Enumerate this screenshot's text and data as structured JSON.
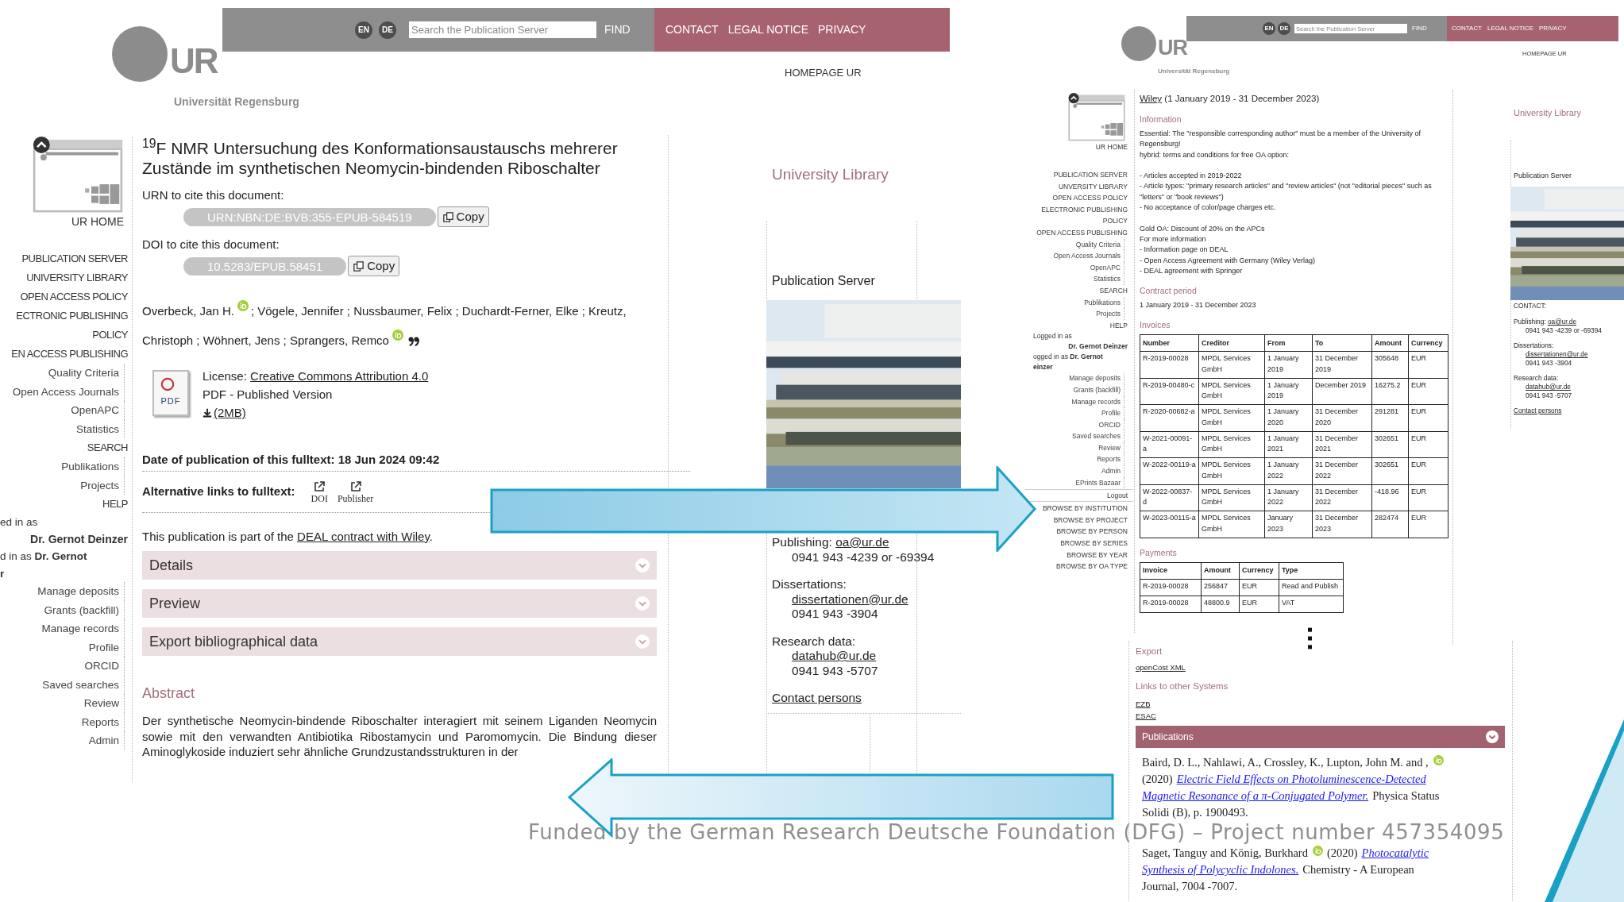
{
  "left_page": {
    "logo": {
      "mark": "UR",
      "name": "Universität Regensburg"
    },
    "languages": [
      {
        "label": "EN"
      },
      {
        "label": "DE"
      }
    ],
    "search": {
      "placeholder": "Search the Publication Server",
      "button": "FIND"
    },
    "top_links": [
      "CONTACT",
      "LEGAL NOTICE",
      "PRIVACY"
    ],
    "homepage_link": "HOMEPAGE UR",
    "home_label": "UR HOME",
    "sidebar": [
      {
        "kind": "main",
        "label": "PUBLICATION SERVER"
      },
      {
        "kind": "main",
        "label": "UNIVERSITY LIBRARY"
      },
      {
        "kind": "main",
        "label": "OPEN ACCESS POLICY"
      },
      {
        "kind": "main",
        "label": "ECTRONIC PUBLISHING"
      },
      {
        "kind": "main",
        "label": "POLICY"
      },
      {
        "kind": "main",
        "label": "EN ACCESS PUBLISHING"
      },
      {
        "kind": "sub",
        "label": "Quality Criteria"
      },
      {
        "kind": "sub",
        "label": "Open Access Journals"
      },
      {
        "kind": "sub",
        "label": "OpenAPC"
      },
      {
        "kind": "sub",
        "label": "Statistics"
      },
      {
        "kind": "main",
        "label": "SEARCH"
      },
      {
        "kind": "sub",
        "label": "Publikations"
      },
      {
        "kind": "sub",
        "label": "Projects"
      },
      {
        "kind": "main",
        "label": "HELP"
      },
      {
        "kind": "login",
        "label": "ed in as"
      },
      {
        "kind": "user",
        "label": "Dr. Gernot Deinzer"
      },
      {
        "kind": "login",
        "label": "d in as **Dr. Gernot**"
      },
      {
        "kind": "login",
        "label": "**r**"
      },
      {
        "kind": "sub",
        "label": "Manage deposits"
      },
      {
        "kind": "sub",
        "label": "Grants (backfill)"
      },
      {
        "kind": "sub",
        "label": "Manage records"
      },
      {
        "kind": "sub",
        "label": "Profile"
      },
      {
        "kind": "sub",
        "label": "ORCID"
      },
      {
        "kind": "sub",
        "label": "Saved searches"
      },
      {
        "kind": "sub",
        "label": "Review"
      },
      {
        "kind": "sub",
        "label": "Reports"
      },
      {
        "kind": "sub",
        "label": "Admin"
      }
    ],
    "record": {
      "title": "$^{19}$F NMR Untersuchung des Konformationsaustauschs mehrerer Zustände im synthetischen Neomycin-bindenden Riboschalter",
      "identifiers": [
        {
          "label": "URN to cite this document:",
          "value": "URN:NBN:DE:BVB:355-EPUB-584519",
          "button": "Copy"
        },
        {
          "label": "DOI to cite this document:",
          "value": "10.5283/EPUB.58451",
          "button": "Copy"
        }
      ],
      "author_lines": [
        [
          {
            "kind": "text",
            "text": "Overbeck, Jan H."
          },
          {
            "kind": "orcid"
          },
          {
            "kind": "text",
            "text": "; Vögele, Jennifer ; Nussbaumer, Felix ; Duchardt-Ferner, Elke ; Kreutz,"
          }
        ],
        [
          {
            "kind": "text",
            "text": "Christoph ; Wöhnert, Jens ; Sprangers, Remco"
          },
          {
            "kind": "orcid"
          },
          {
            "kind": "cite"
          }
        ]
      ],
      "file": {
        "icon_label": "PDF",
        "license_label": "License: ",
        "license_link": "Creative Commons Attribution 4.0",
        "version": "PDF - Published Version",
        "download": "(2MB)"
      },
      "date": "Date of publication of this fulltext: 18 Jun 2024 09:42",
      "alt_links": {
        "label": "Alternative links to fulltext:",
        "links": [
          "DOI",
          "Publisher"
        ]
      },
      "deal_notice": {
        "before": "This publication is part of the ",
        "link": "DEAL contract with Wiley",
        "after": "."
      },
      "accordions": [
        {
          "label": "Details",
          "expanded": false
        },
        {
          "label": "Preview",
          "expanded": false
        },
        {
          "label": "Export bibliographical data",
          "expanded": false
        }
      ],
      "abstract": {
        "heading": "Abstract",
        "text": "Der synthetische Neomycin-bindende Riboschalter interagiert mit seinem Liganden Neomycin sowie mit den verwandten Antibiotika Ribostamycin und Paromomycin. Die Bindung dieser Aminoglykoside induziert sehr ähnliche Grundzustandsstrukturen in der"
      }
    },
    "side": {
      "heading": "University Library",
      "server": "Publication Server",
      "contacts": [
        {
          "kind": "inline",
          "label": "Publishing:",
          "email": "oa@ur.de",
          "phone": "0941 943 -4239 or -69394"
        },
        {
          "kind": "stacked",
          "label": "Dissertations:",
          "email": "dissertationen@ur.de",
          "phone": "0941 943 -3904"
        },
        {
          "kind": "stacked",
          "label": "Research data:",
          "email": "datahub@ur.de",
          "phone": "0941 943 -5707"
        }
      ],
      "contact_persons": "Contact persons"
    }
  },
  "right_page": {
    "logo": {
      "mark": "UR",
      "name": "Universität Regensburg"
    },
    "languages": [
      {
        "label": "EN"
      },
      {
        "label": "DE"
      }
    ],
    "search": {
      "placeholder": "Search the Publication Server",
      "button": "FIND"
    },
    "top_links": [
      "CONTACT",
      "LEGAL NOTICE",
      "PRIVACY"
    ],
    "homepage_link": "HOMEPAGE UR",
    "home_label": "UR HOME",
    "sidebar": [
      {
        "kind": "main",
        "label": "PUBLICATION SERVER"
      },
      {
        "kind": "main",
        "label": "UNVERSITY LIBRARY"
      },
      {
        "kind": "main",
        "label": "OPEN ACCESS POLICY"
      },
      {
        "kind": "main",
        "label": "ELECTRONIC PUBLISHING"
      },
      {
        "kind": "main",
        "label": "POLICY"
      },
      {
        "kind": "main",
        "label": "OPEN ACCESS PUBLISHING"
      },
      {
        "kind": "sub",
        "label": "Quality Criteria"
      },
      {
        "kind": "sub",
        "label": "Open Access Journals"
      },
      {
        "kind": "sub",
        "label": "OpenAPC"
      },
      {
        "kind": "sub",
        "label": "Statistics"
      },
      {
        "kind": "main",
        "label": "SEARCH"
      },
      {
        "kind": "sub",
        "label": "Publikations"
      },
      {
        "kind": "sub",
        "label": "Projects"
      },
      {
        "kind": "main",
        "label": "HELP"
      },
      {
        "kind": "login",
        "label": "Logged in as"
      },
      {
        "kind": "user",
        "label": "Dr. Gernot Deinzer"
      },
      {
        "kind": "login",
        "label": "ogged in as **Dr. Gernot**"
      },
      {
        "kind": "login",
        "label": "**einzer**"
      },
      {
        "kind": "sub",
        "label": "Manage deposits"
      },
      {
        "kind": "sub",
        "label": "Grants (backfill)"
      },
      {
        "kind": "sub",
        "label": "Manage records"
      },
      {
        "kind": "sub",
        "label": "Profile"
      },
      {
        "kind": "sub",
        "label": "ORCID"
      },
      {
        "kind": "sub",
        "label": "Saved searches"
      },
      {
        "kind": "sub",
        "label": "Review"
      },
      {
        "kind": "sub",
        "label": "Reports"
      },
      {
        "kind": "sub",
        "label": "Admin"
      },
      {
        "kind": "sub",
        "label": "EPrints Bazaar"
      },
      {
        "kind": "logout",
        "label": "Logout"
      },
      {
        "kind": "main",
        "label": "BROWSE BY INSTITUTION"
      },
      {
        "kind": "main",
        "label": "BROWSE BY PROJECT"
      },
      {
        "kind": "main",
        "label": "BROWSE BY PERSON"
      },
      {
        "kind": "main",
        "label": "BROWSE BY SERIES"
      },
      {
        "kind": "main",
        "label": "BROWSE BY YEAR"
      },
      {
        "kind": "main",
        "label": "BROWSE BY OA TYPE"
      }
    ],
    "agreement": {
      "publisher": "Wiley",
      "period": "(1 January 2019 - 31 December 2023)",
      "information": {
        "heading": "Information",
        "paragraphs": [
          [
            "Essential: The \"responsible corresponding author\" must be a member of the University of Regensburg!",
            "hybrid: terms and conditions for free OA option:"
          ],
          [
            "- Articles accepted in 2019-2022",
            "- Article types: \"primary research articles\" and \"review articles\" (not \"editorial pieces\" such as \"letters\" or \"book reviews\")",
            "- No acceptance of color/page charges etc."
          ],
          [
            "Gold OA: Discount of 20% on the APCs",
            "For more information",
            "- Information page on DEAL",
            "- Open Access Agreement with Germany (Wiley Verlag)",
            "- DEAL agreement with Springer"
          ]
        ]
      },
      "contract": {
        "heading": "Contract period",
        "text": "1 January 2019 - 31 December 2023"
      },
      "invoices": {
        "heading": "Invoices",
        "columns": [
          "Number",
          "Creditor",
          "From",
          "To",
          "Amount",
          "Currency"
        ],
        "rows": [
          [
            "R-2019-00028",
            "MPDL Services GmbH",
            "1 January 2019",
            "31 December 2019",
            "305648",
            "EUR"
          ],
          [
            "R-2019-00480-c",
            "MPDL Services GmbH",
            "1 January 2019",
            "December 2019",
            "16275.2",
            "EUR"
          ],
          [
            "R-2020-00682-a",
            "MPDL Services GmbH",
            "1 January 2020",
            "31 December 2020",
            "291281",
            "EUR"
          ],
          [
            "W-2021-00091-a",
            "MPDL Services GmbH",
            "1 January 2021",
            "31 December 2021",
            "302651",
            "EUR"
          ],
          [
            "W-2022-00119-a",
            "MPDL Services GmbH",
            "1 January 2022",
            "31 December 2022",
            "302651",
            "EUR"
          ],
          [
            "W-2022-00837-d",
            "MPDL Services GmbH",
            "1 January 2022",
            "31 December 2022",
            "-418.96",
            "EUR"
          ],
          [
            "W-2023-00115-a",
            "MPDL Services GmbH",
            "January 2023",
            "31 December 2023",
            "282474",
            "EUR"
          ]
        ]
      },
      "payments": {
        "heading": "Payments",
        "columns": [
          "Invoice",
          "Amount",
          "Currency",
          "Type"
        ],
        "rows": [
          [
            "R-2019-00028",
            "256847",
            "EUR",
            "Read and Publish"
          ],
          [
            "R-2019-00028",
            "48800.9",
            "EUR",
            "VAT"
          ]
        ]
      }
    },
    "side": {
      "heading": "University Library",
      "server": "Publication Server",
      "contact_heading": "CONTACT:",
      "contacts": [
        {
          "kind": "inline",
          "label": "Publishing:",
          "email": "oa@ur.de",
          "phone": "0941 943 -4239 or -69394"
        },
        {
          "kind": "stacked",
          "label": "Dissertations:",
          "email": "dissertationen@ur.de",
          "phone": "0941 943 -3904"
        },
        {
          "kind": "stacked",
          "label": "Research data:",
          "email": "datahub@ur.de",
          "phone": "0941 943 -5707"
        }
      ],
      "contact_persons": "Contact persons"
    },
    "lower": {
      "export": {
        "heading": "Export",
        "links": [
          "openCost XML"
        ]
      },
      "systems": {
        "heading": "Links to other Systems",
        "links": [
          "EZB",
          "ESAC"
        ]
      },
      "publications": {
        "label": "Publications",
        "expanded": false,
        "entries": [
          [
            [
              {
                "kind": "text",
                "text": "Baird, D. L., Nahlawi, A., Crossley, K., Lupton, John M. and ,"
              },
              {
                "kind": "orcid"
              }
            ],
            [
              {
                "kind": "text",
                "text": "(2020)"
              },
              {
                "kind": "link",
                "text": "Electric Field Effects on Photoluminescence-Detected"
              }
            ],
            [
              {
                "kind": "link",
                "text": "Magnetic Resonance of a π-Conjugated Polymer."
              },
              {
                "kind": "text",
                "text": "Physica Status"
              }
            ],
            [
              {
                "kind": "text",
                "text": "Solidi (B), p. 1900493."
              }
            ]
          ],
          [
            [
              {
                "kind": "text",
                "text": "Saget, Tanguy and König, Burkhard"
              },
              {
                "kind": "orcid"
              },
              {
                "kind": "text",
                "text": "(2020)"
              },
              {
                "kind": "link",
                "text": "Photocatalytic"
              }
            ],
            [
              {
                "kind": "link",
                "text": "Synthesis of Polycyclic Indolones."
              },
              {
                "kind": "text",
                "text": "Chemistry - A European"
              }
            ],
            [
              {
                "kind": "text",
                "text": "Journal, 7004 -7007."
              }
            ]
          ]
        ]
      }
    }
  },
  "caption": "Funded by the German Research Deutsche Foundation (DFG) – Project number 457354095"
}
